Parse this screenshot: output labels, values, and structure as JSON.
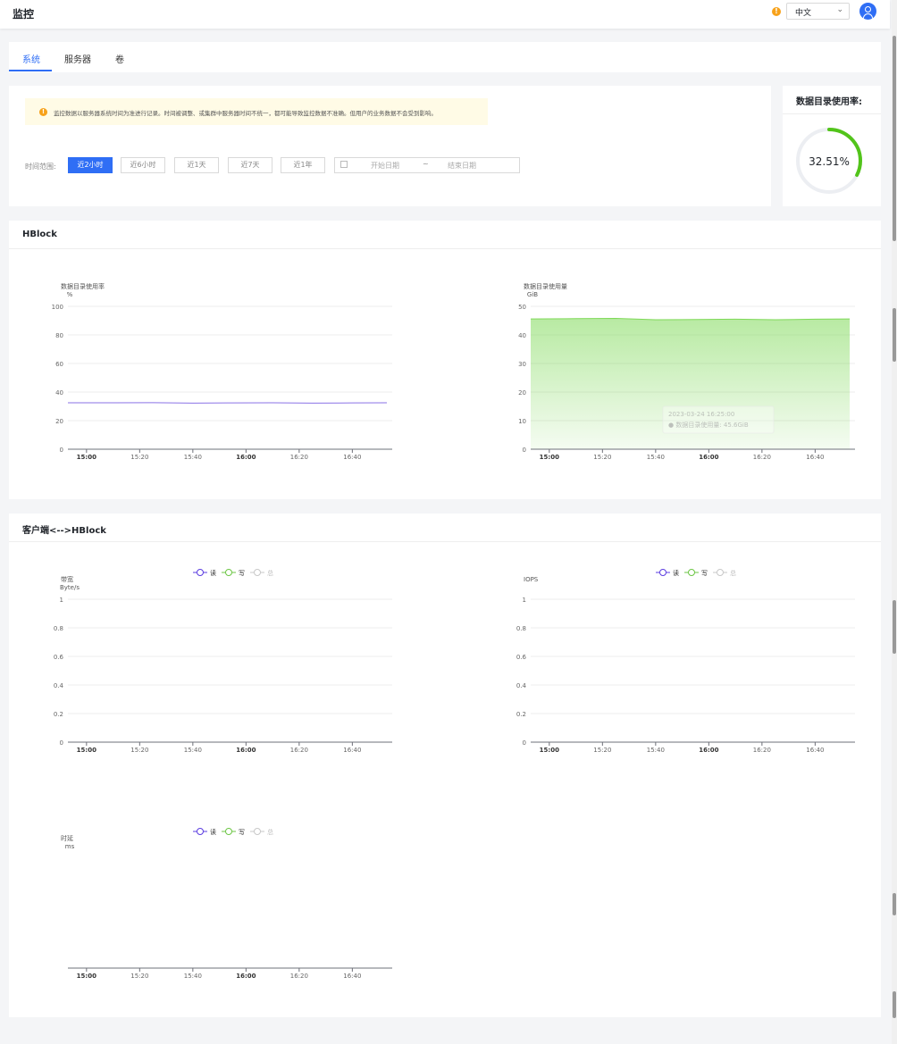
{
  "header": {
    "title": "监控",
    "language": "中文"
  },
  "tabs": [
    {
      "label": "系统"
    },
    {
      "label": "服务器"
    },
    {
      "label": "卷"
    }
  ],
  "notice": {
    "text": "监控数据以服务器系统时间为准进行记录。时间被调整、或集群中服务器时间不统一，都可能导致监控数据不准确。但用户的业务数据不会受到影响。"
  },
  "time_range": {
    "label": "时间范围:",
    "buttons": [
      "近2小时",
      "近6小时",
      "近1天",
      "近7天",
      "近1年"
    ],
    "active_index": 0,
    "start_placeholder": "开始日期",
    "separator": "~",
    "end_placeholder": "结束日期"
  },
  "usage": {
    "title": "数据目录使用率:",
    "value_text": "32.51%",
    "fraction": 0.3251
  },
  "colors": {
    "accent": "#2f6ef5",
    "read": "#5b3ce0",
    "write": "#6cc644",
    "total": "#c8c8c8",
    "ring": "#52c41a",
    "area": "#7ed957"
  },
  "sections": {
    "hblock": "HBlock",
    "client": "客户端<-->HBlock"
  },
  "chart_data": [
    {
      "type": "line",
      "ylabel": "数据目录使用率",
      "unit": "%",
      "yticks": [
        "0",
        "20",
        "40",
        "60",
        "80",
        "100"
      ],
      "ylim": [
        0,
        100
      ],
      "xticks": [
        "15:00",
        "15:20",
        "15:40",
        "16:00",
        "16:20",
        "16:40"
      ],
      "bold_xticks": [
        "15:00",
        "16:00"
      ],
      "x": [
        "14:53",
        "15:10",
        "15:25",
        "15:40",
        "15:55",
        "16:10",
        "16:25",
        "16:40",
        "16:53"
      ],
      "series": [
        {
          "values": [
            32.5,
            32.5,
            32.6,
            32.3,
            32.4,
            32.5,
            32.3,
            32.4,
            32.5
          ]
        }
      ]
    },
    {
      "type": "area",
      "ylabel": "数据目录使用量",
      "unit": "GiB",
      "yticks": [
        "0",
        "10",
        "20",
        "30",
        "40",
        "50"
      ],
      "ylim": [
        0,
        50
      ],
      "xticks": [
        "15:00",
        "15:20",
        "15:40",
        "16:00",
        "16:20",
        "16:40"
      ],
      "bold_xticks": [
        "15:00",
        "16:00"
      ],
      "x": [
        "14:53",
        "15:10",
        "15:25",
        "15:40",
        "15:55",
        "16:10",
        "16:25",
        "16:40",
        "16:53"
      ],
      "series": [
        {
          "values": [
            45.6,
            45.7,
            45.8,
            45.3,
            45.4,
            45.5,
            45.3,
            45.5,
            45.6
          ]
        }
      ],
      "tooltip": {
        "time": "2023-03-24 16:25:00",
        "label": "数据目录使用量:",
        "value": "45.6GiB"
      }
    },
    {
      "type": "line",
      "ylabel": "带宽",
      "unit": "Byte/s",
      "legend": [
        "读",
        "写",
        "总"
      ],
      "yticks": [
        "0",
        "0.2",
        "0.4",
        "0.6",
        "0.8",
        "1"
      ],
      "ylim": [
        0,
        1
      ],
      "xticks": [
        "15:00",
        "15:20",
        "15:40",
        "16:00",
        "16:20",
        "16:40"
      ],
      "bold_xticks": [
        "15:00",
        "16:00"
      ],
      "series": [
        {
          "name": "读",
          "values": [
            0,
            0
          ]
        },
        {
          "name": "写",
          "values": [
            0,
            0
          ]
        }
      ]
    },
    {
      "type": "line",
      "ylabel": "IOPS",
      "unit": "",
      "legend": [
        "读",
        "写",
        "总"
      ],
      "yticks": [
        "0",
        "0.2",
        "0.4",
        "0.6",
        "0.8",
        "1"
      ],
      "ylim": [
        0,
        1
      ],
      "xticks": [
        "15:00",
        "15:20",
        "15:40",
        "16:00",
        "16:20",
        "16:40"
      ],
      "bold_xticks": [
        "15:00",
        "16:00"
      ],
      "series": [
        {
          "name": "读",
          "values": [
            0,
            0
          ]
        },
        {
          "name": "写",
          "values": [
            0,
            0
          ]
        }
      ]
    },
    {
      "type": "line",
      "ylabel": "时延",
      "unit": "ms",
      "legend": [
        "读",
        "写",
        "总"
      ],
      "yticks": [],
      "xticks": [
        "15:00",
        "15:20",
        "15:40",
        "16:00",
        "16:20",
        "16:40"
      ],
      "bold_xticks": [
        "15:00",
        "16:00"
      ],
      "series": []
    }
  ]
}
